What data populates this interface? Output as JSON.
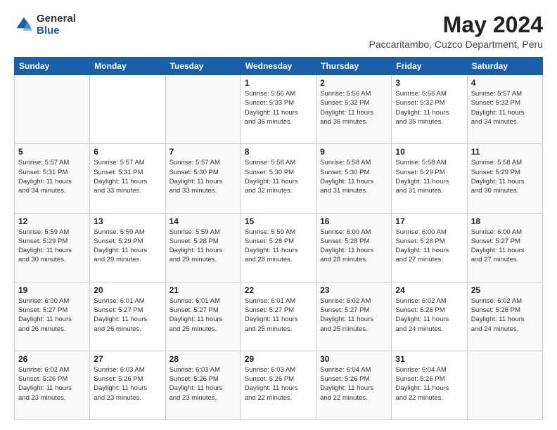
{
  "header": {
    "logo": {
      "general": "General",
      "blue": "Blue"
    },
    "title": "May 2024",
    "subtitle": "Paccaritambo, Cuzco Department, Peru"
  },
  "calendar": {
    "days_of_week": [
      "Sunday",
      "Monday",
      "Tuesday",
      "Wednesday",
      "Thursday",
      "Friday",
      "Saturday"
    ],
    "weeks": [
      [
        {
          "day": "",
          "info": ""
        },
        {
          "day": "",
          "info": ""
        },
        {
          "day": "",
          "info": ""
        },
        {
          "day": "1",
          "info": "Sunrise: 5:56 AM\nSunset: 5:33 PM\nDaylight: 11 hours\nand 36 minutes."
        },
        {
          "day": "2",
          "info": "Sunrise: 5:56 AM\nSunset: 5:32 PM\nDaylight: 11 hours\nand 36 minutes."
        },
        {
          "day": "3",
          "info": "Sunrise: 5:56 AM\nSunset: 5:32 PM\nDaylight: 11 hours\nand 35 minutes."
        },
        {
          "day": "4",
          "info": "Sunrise: 5:57 AM\nSunset: 5:32 PM\nDaylight: 11 hours\nand 34 minutes."
        }
      ],
      [
        {
          "day": "5",
          "info": "Sunrise: 5:57 AM\nSunset: 5:31 PM\nDaylight: 11 hours\nand 34 minutes."
        },
        {
          "day": "6",
          "info": "Sunrise: 5:57 AM\nSunset: 5:31 PM\nDaylight: 11 hours\nand 33 minutes."
        },
        {
          "day": "7",
          "info": "Sunrise: 5:57 AM\nSunset: 5:30 PM\nDaylight: 11 hours\nand 33 minutes."
        },
        {
          "day": "8",
          "info": "Sunrise: 5:58 AM\nSunset: 5:30 PM\nDaylight: 11 hours\nand 32 minutes."
        },
        {
          "day": "9",
          "info": "Sunrise: 5:58 AM\nSunset: 5:30 PM\nDaylight: 11 hours\nand 31 minutes."
        },
        {
          "day": "10",
          "info": "Sunrise: 5:58 AM\nSunset: 5:29 PM\nDaylight: 11 hours\nand 31 minutes."
        },
        {
          "day": "11",
          "info": "Sunrise: 5:58 AM\nSunset: 5:29 PM\nDaylight: 11 hours\nand 30 minutes."
        }
      ],
      [
        {
          "day": "12",
          "info": "Sunrise: 5:59 AM\nSunset: 5:29 PM\nDaylight: 11 hours\nand 30 minutes."
        },
        {
          "day": "13",
          "info": "Sunrise: 5:59 AM\nSunset: 5:29 PM\nDaylight: 11 hours\nand 29 minutes."
        },
        {
          "day": "14",
          "info": "Sunrise: 5:59 AM\nSunset: 5:28 PM\nDaylight: 11 hours\nand 29 minutes."
        },
        {
          "day": "15",
          "info": "Sunrise: 5:59 AM\nSunset: 5:28 PM\nDaylight: 11 hours\nand 28 minutes."
        },
        {
          "day": "16",
          "info": "Sunrise: 6:00 AM\nSunset: 5:28 PM\nDaylight: 11 hours\nand 28 minutes."
        },
        {
          "day": "17",
          "info": "Sunrise: 6:00 AM\nSunset: 5:28 PM\nDaylight: 11 hours\nand 27 minutes."
        },
        {
          "day": "18",
          "info": "Sunrise: 6:00 AM\nSunset: 5:27 PM\nDaylight: 11 hours\nand 27 minutes."
        }
      ],
      [
        {
          "day": "19",
          "info": "Sunrise: 6:00 AM\nSunset: 5:27 PM\nDaylight: 11 hours\nand 26 minutes."
        },
        {
          "day": "20",
          "info": "Sunrise: 6:01 AM\nSunset: 5:27 PM\nDaylight: 11 hours\nand 26 minutes."
        },
        {
          "day": "21",
          "info": "Sunrise: 6:01 AM\nSunset: 5:27 PM\nDaylight: 11 hours\nand 25 minutes."
        },
        {
          "day": "22",
          "info": "Sunrise: 6:01 AM\nSunset: 5:27 PM\nDaylight: 11 hours\nand 25 minutes."
        },
        {
          "day": "23",
          "info": "Sunrise: 6:02 AM\nSunset: 5:27 PM\nDaylight: 11 hours\nand 25 minutes."
        },
        {
          "day": "24",
          "info": "Sunrise: 6:02 AM\nSunset: 5:26 PM\nDaylight: 11 hours\nand 24 minutes."
        },
        {
          "day": "25",
          "info": "Sunrise: 6:02 AM\nSunset: 5:26 PM\nDaylight: 11 hours\nand 24 minutes."
        }
      ],
      [
        {
          "day": "26",
          "info": "Sunrise: 6:02 AM\nSunset: 5:26 PM\nDaylight: 11 hours\nand 23 minutes."
        },
        {
          "day": "27",
          "info": "Sunrise: 6:03 AM\nSunset: 5:26 PM\nDaylight: 11 hours\nand 23 minutes."
        },
        {
          "day": "28",
          "info": "Sunrise: 6:03 AM\nSunset: 5:26 PM\nDaylight: 11 hours\nand 23 minutes."
        },
        {
          "day": "29",
          "info": "Sunrise: 6:03 AM\nSunset: 5:26 PM\nDaylight: 11 hours\nand 22 minutes."
        },
        {
          "day": "30",
          "info": "Sunrise: 6:04 AM\nSunset: 5:26 PM\nDaylight: 11 hours\nand 22 minutes."
        },
        {
          "day": "31",
          "info": "Sunrise: 6:04 AM\nSunset: 5:26 PM\nDaylight: 11 hours\nand 22 minutes."
        },
        {
          "day": "",
          "info": ""
        }
      ]
    ]
  }
}
